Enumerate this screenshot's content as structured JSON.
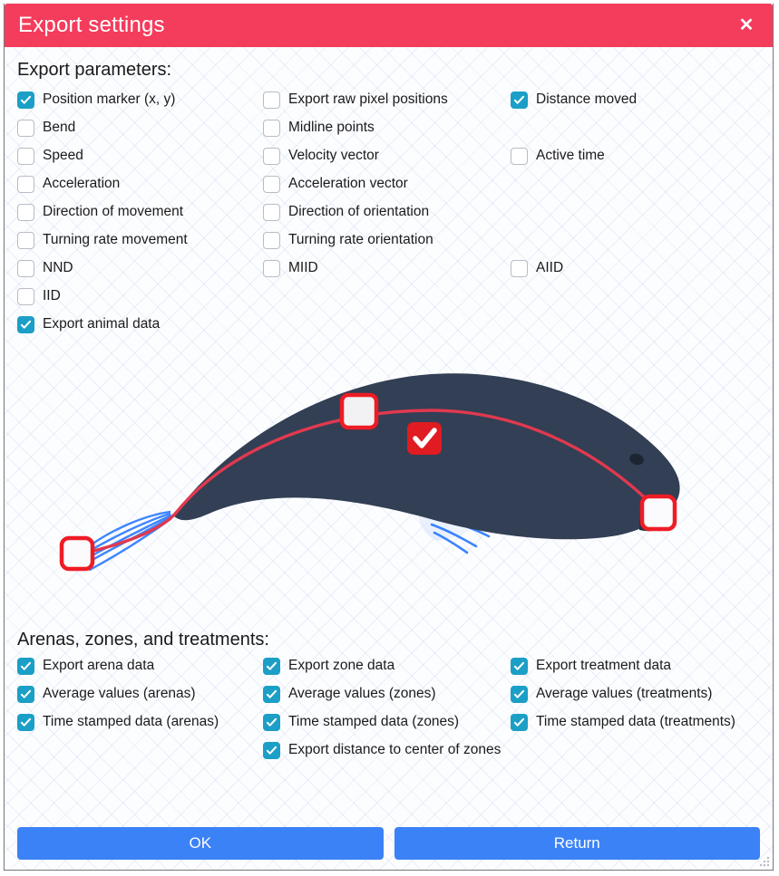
{
  "window": {
    "title": "Export settings",
    "close_label": "✕",
    "accent_title_bar": "#f43c5c",
    "accent_checked": "#1c9fc6",
    "accent_button": "#3b82f6"
  },
  "parameters_section": {
    "heading": "Export parameters:",
    "column1": [
      {
        "label": "Position marker (x, y)",
        "checked": true
      },
      {
        "label": "Bend",
        "checked": false
      },
      {
        "label": "Speed",
        "checked": false
      },
      {
        "label": "Acceleration",
        "checked": false
      },
      {
        "label": "Direction of movement",
        "checked": false
      },
      {
        "label": "Turning rate movement",
        "checked": false
      },
      {
        "label": "NND",
        "checked": false
      },
      {
        "label": "IID",
        "checked": false
      },
      {
        "label": "Export animal data",
        "checked": true
      }
    ],
    "column2": [
      {
        "label": "Export raw pixel positions",
        "checked": false
      },
      {
        "label": "Midline points",
        "checked": false
      },
      {
        "label": "Velocity vector",
        "checked": false
      },
      {
        "label": "Acceleration vector",
        "checked": false
      },
      {
        "label": "Direction of orientation",
        "checked": false
      },
      {
        "label": "Turning rate orientation",
        "checked": false
      },
      {
        "label": "MIID",
        "checked": false
      }
    ],
    "column3": [
      {
        "label": "Distance moved",
        "checked": true,
        "row": 0
      },
      {
        "label": "Active time",
        "checked": false,
        "row": 2
      },
      {
        "label": "AIID",
        "checked": false,
        "row": 6
      }
    ]
  },
  "illustration": {
    "name": "fish-midline-diagram",
    "body_color": "#323f54",
    "midline_color": "#e0394f",
    "fin_color": "#2979ff",
    "marker_color": "#ee1c25",
    "badge_color": "#e01b22",
    "markers": [
      {
        "name": "tail-marker",
        "selected": false
      },
      {
        "name": "mid-marker",
        "selected": false
      },
      {
        "name": "head-marker",
        "selected": false
      }
    ],
    "badge": "✓"
  },
  "arenas_section": {
    "heading": "Arenas, zones, and treatments:",
    "column1": [
      {
        "label": "Export arena data",
        "checked": true
      },
      {
        "label": "Average values (arenas)",
        "checked": true
      },
      {
        "label": "Time stamped data (arenas)",
        "checked": true
      }
    ],
    "column2": [
      {
        "label": "Export zone data",
        "checked": true
      },
      {
        "label": "Average values (zones)",
        "checked": true
      },
      {
        "label": "Time stamped data (zones)",
        "checked": true
      },
      {
        "label": "Export distance to center of zones",
        "checked": true
      }
    ],
    "column3": [
      {
        "label": "Export treatment data",
        "checked": true
      },
      {
        "label": "Average values (treatments)",
        "checked": true
      },
      {
        "label": "Time stamped data (treatments)",
        "checked": true
      }
    ]
  },
  "footer": {
    "ok_label": "OK",
    "return_label": "Return"
  }
}
